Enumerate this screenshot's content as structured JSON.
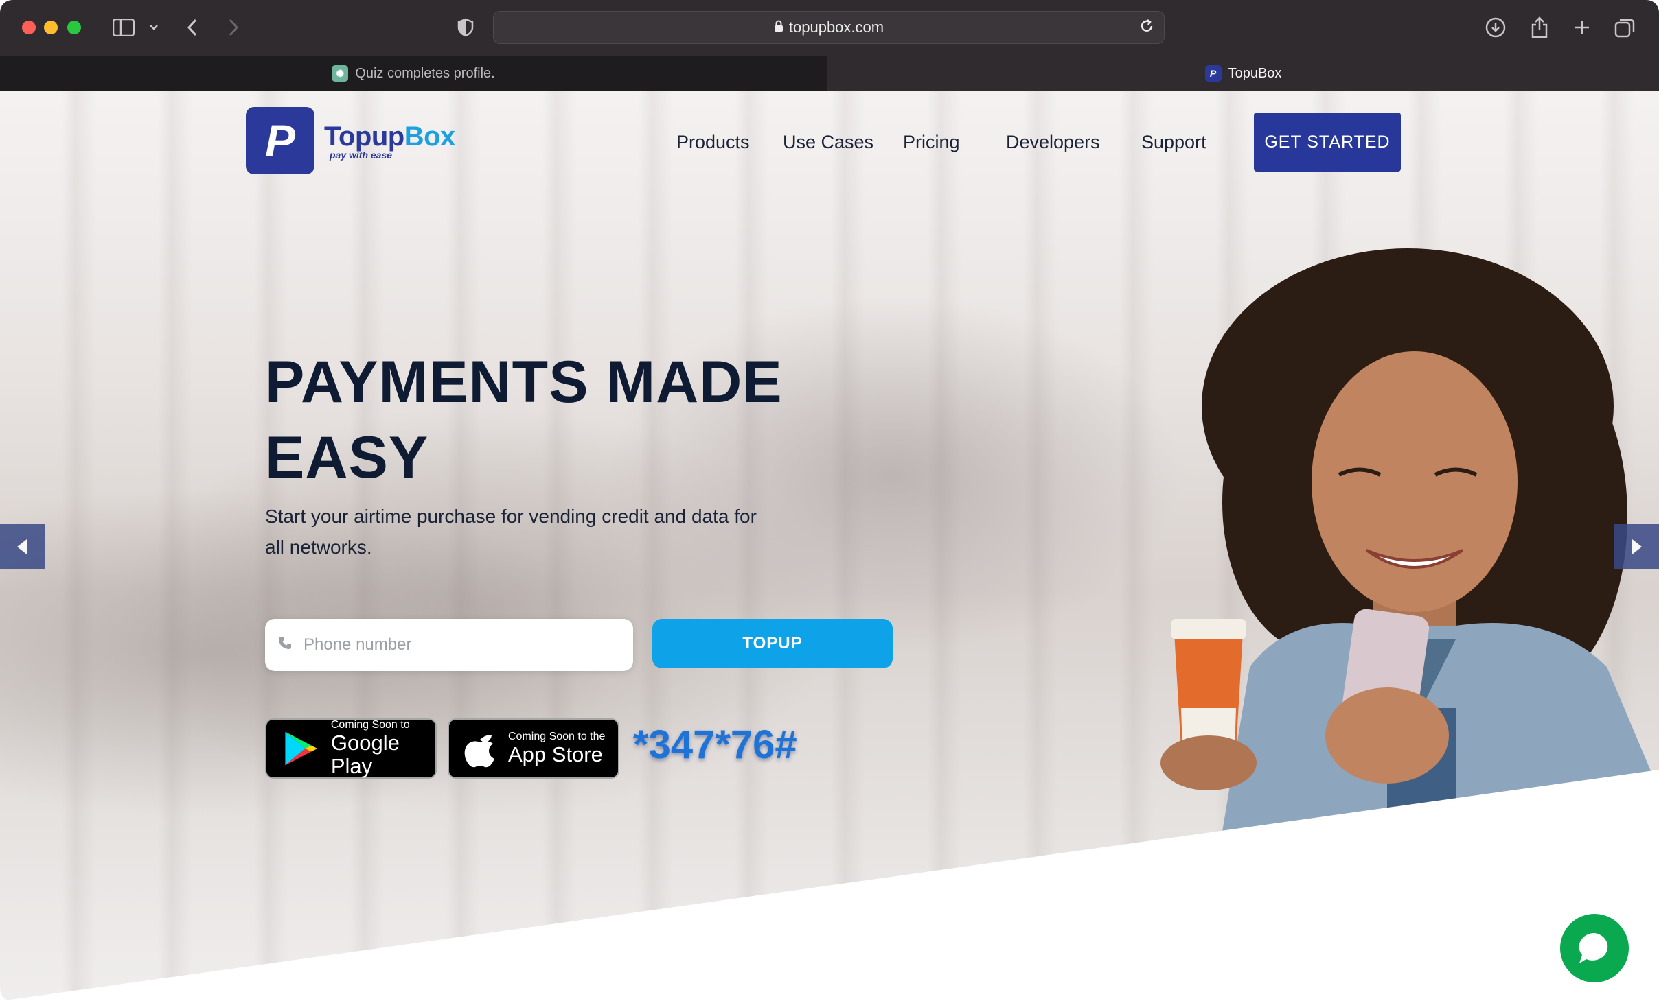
{
  "browser": {
    "url": "topupbox.com",
    "tabs": [
      {
        "label": "Quiz completes profile.",
        "active": false,
        "favicon": "chatgpt-icon"
      },
      {
        "label": "TopuBox",
        "active": true,
        "favicon": "topupbox-favicon"
      }
    ]
  },
  "site": {
    "logo": {
      "name_part1": "Topup",
      "name_part2": "Box",
      "tagline": "pay with ease"
    },
    "nav": [
      {
        "label": "Products"
      },
      {
        "label": "Use Cases"
      },
      {
        "label": "Pricing"
      },
      {
        "label": "Developers"
      },
      {
        "label": "Support"
      }
    ],
    "cta_label": "GET STARTED"
  },
  "hero": {
    "title_line1": "PAYMENTS MADE",
    "title_line2": "EASY",
    "subtitle": "Start your airtime purchase for vending credit and data for all networks.",
    "phone_placeholder": "Phone number",
    "topup_label": "TOPUP",
    "google_play": {
      "small": "Coming Soon to",
      "big": "Google Play"
    },
    "app_store": {
      "small": "Coming Soon to the",
      "big": "App Store"
    },
    "ussd_code": "*347*76#"
  },
  "colors": {
    "brand_navy": "#27389a",
    "brand_blue": "#0ea3e9",
    "chat_green": "#0aa84f"
  }
}
